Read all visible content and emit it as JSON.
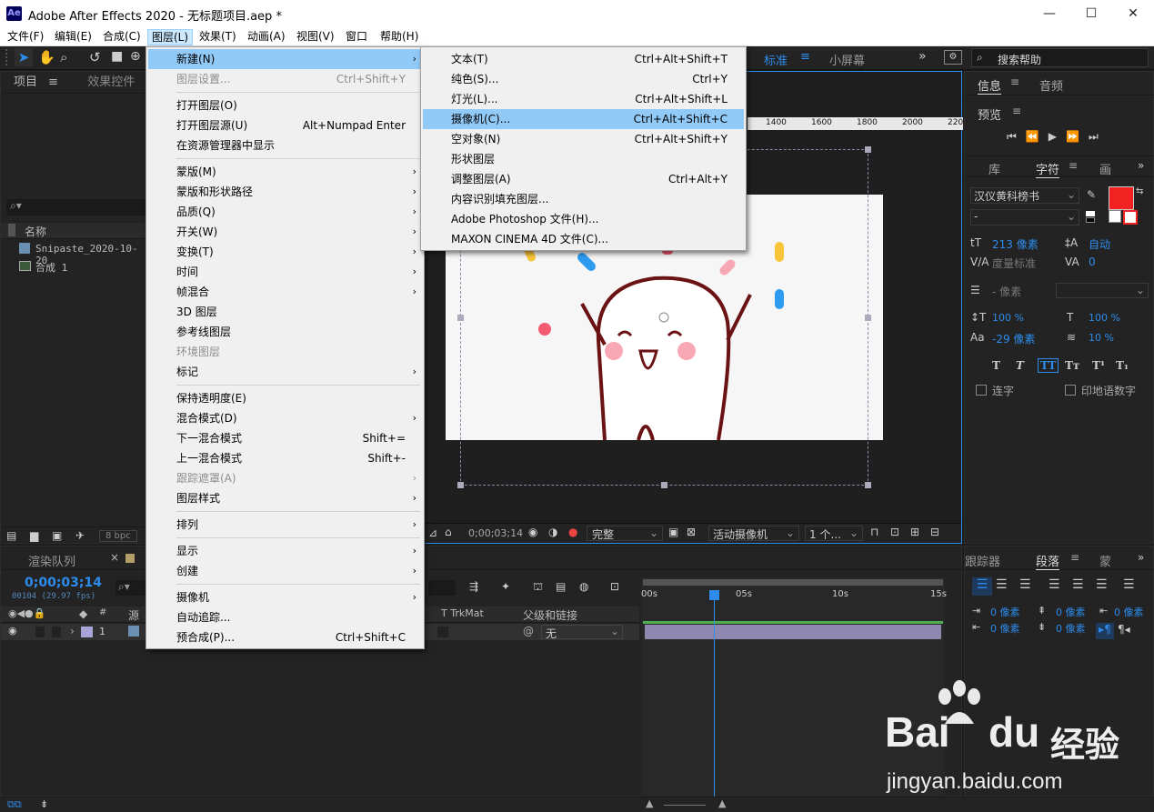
{
  "window": {
    "title": "Adobe After Effects 2020 - 无标题项目.aep *",
    "logo": "Ae",
    "min": "—",
    "max": "☐",
    "close": "✕"
  },
  "menubar": [
    "文件(F)",
    "编辑(E)",
    "合成(C)",
    "图层(L)",
    "效果(T)",
    "动画(A)",
    "视图(V)",
    "窗口",
    "帮助(H)"
  ],
  "toolbar": {
    "bpc": "8 bpc",
    "workspace": "标准",
    "small_screen": "小屏幕",
    "search_placeholder": "搜索帮助"
  },
  "project": {
    "tab": "项目",
    "effects_tab": "效果控件",
    "col_name": "名称",
    "items": [
      "Snipaste_2020-10-20_",
      "合成 1"
    ]
  },
  "layer_menu": {
    "items": [
      {
        "label": "新建(N)",
        "sub": true,
        "hl": true
      },
      {
        "label": "图层设置...",
        "sc": "Ctrl+Shift+Y",
        "dis": true
      },
      {
        "sep": true
      },
      {
        "label": "打开图层(O)"
      },
      {
        "label": "打开图层源(U)",
        "sc": "Alt+Numpad Enter"
      },
      {
        "label": "在资源管理器中显示"
      },
      {
        "sep": true
      },
      {
        "label": "蒙版(M)",
        "sub": true
      },
      {
        "label": "蒙版和形状路径",
        "sub": true
      },
      {
        "label": "品质(Q)",
        "sub": true
      },
      {
        "label": "开关(W)",
        "sub": true
      },
      {
        "label": "变换(T)",
        "sub": true
      },
      {
        "label": "时间",
        "sub": true
      },
      {
        "label": "帧混合",
        "sub": true
      },
      {
        "label": "3D 图层"
      },
      {
        "label": "参考线图层"
      },
      {
        "label": "环境图层",
        "dis": true
      },
      {
        "label": "标记",
        "sub": true
      },
      {
        "sep": true
      },
      {
        "label": "保持透明度(E)"
      },
      {
        "label": "混合模式(D)",
        "sub": true
      },
      {
        "label": "下一混合模式",
        "sc": "Shift+="
      },
      {
        "label": "上一混合模式",
        "sc": "Shift+-"
      },
      {
        "label": "跟踪遮罩(A)",
        "sub": true,
        "dis": true
      },
      {
        "label": "图层样式",
        "sub": true
      },
      {
        "sep": true
      },
      {
        "label": "排列",
        "sub": true
      },
      {
        "sep": true
      },
      {
        "label": "显示",
        "sub": true
      },
      {
        "label": "创建",
        "sub": true
      },
      {
        "sep": true
      },
      {
        "label": "摄像机",
        "sub": true
      },
      {
        "label": "自动追踪..."
      },
      {
        "label": "预合成(P)...",
        "sc": "Ctrl+Shift+C"
      }
    ]
  },
  "new_menu": {
    "items": [
      {
        "label": "文本(T)",
        "sc": "Ctrl+Alt+Shift+T"
      },
      {
        "label": "纯色(S)...",
        "sc": "Ctrl+Y"
      },
      {
        "label": "灯光(L)...",
        "sc": "Ctrl+Alt+Shift+L"
      },
      {
        "label": "摄像机(C)...",
        "sc": "Ctrl+Alt+Shift+C",
        "hl": true
      },
      {
        "label": "空对象(N)",
        "sc": "Ctrl+Alt+Shift+Y"
      },
      {
        "label": "形状图层"
      },
      {
        "label": "调整图层(A)",
        "sc": "Ctrl+Alt+Y"
      },
      {
        "label": "内容识别填充图层..."
      },
      {
        "label": "Adobe Photoshop 文件(H)..."
      },
      {
        "label": "MAXON CINEMA 4D 文件(C)..."
      }
    ]
  },
  "ruler": [
    "1400",
    "1600",
    "1800",
    "2000",
    "220"
  ],
  "viewer": {
    "timecode": "0;00;03;14",
    "quality": "完整",
    "camera": "活动摄像机",
    "views": "1 个..."
  },
  "right": {
    "info": "信息",
    "audio": "音频",
    "preview": "预览",
    "lib": "库",
    "char": "字符",
    "para_short": "画",
    "font": "汉仪黄科榜书",
    "style": "-",
    "size": "213 像素",
    "leading": "自动",
    "kern": "度量标准",
    "track": "0",
    "stroke": "- 像素",
    "vscale": "100 %",
    "hscale": "100 %",
    "baseline": "-29 像素",
    "tsume": "10 %",
    "ligature": "连字",
    "hindi": "印地语数字",
    "tracker": "跟踪器",
    "paragraph": "段落",
    "brush": "蒙",
    "indent": [
      "0 像素",
      "0 像素",
      "0 像素",
      "0 像素",
      "0 像素"
    ]
  },
  "timeline": {
    "render_tab": "渲染队列",
    "timecode": "0;00;03;14",
    "fps": "00104 (29.97 fps)",
    "col_src": "源",
    "col_trkmat": "T  TrkMat",
    "col_parent": "父级和链接",
    "layer_num": "1",
    "parent_val": "无",
    "ticks": [
      "00s",
      "05s",
      "10s",
      "15s"
    ]
  },
  "watermark": {
    "brand": "Bai",
    "brand2": "du",
    "jy": "经验",
    "url": "jingyan.baidu.com"
  }
}
